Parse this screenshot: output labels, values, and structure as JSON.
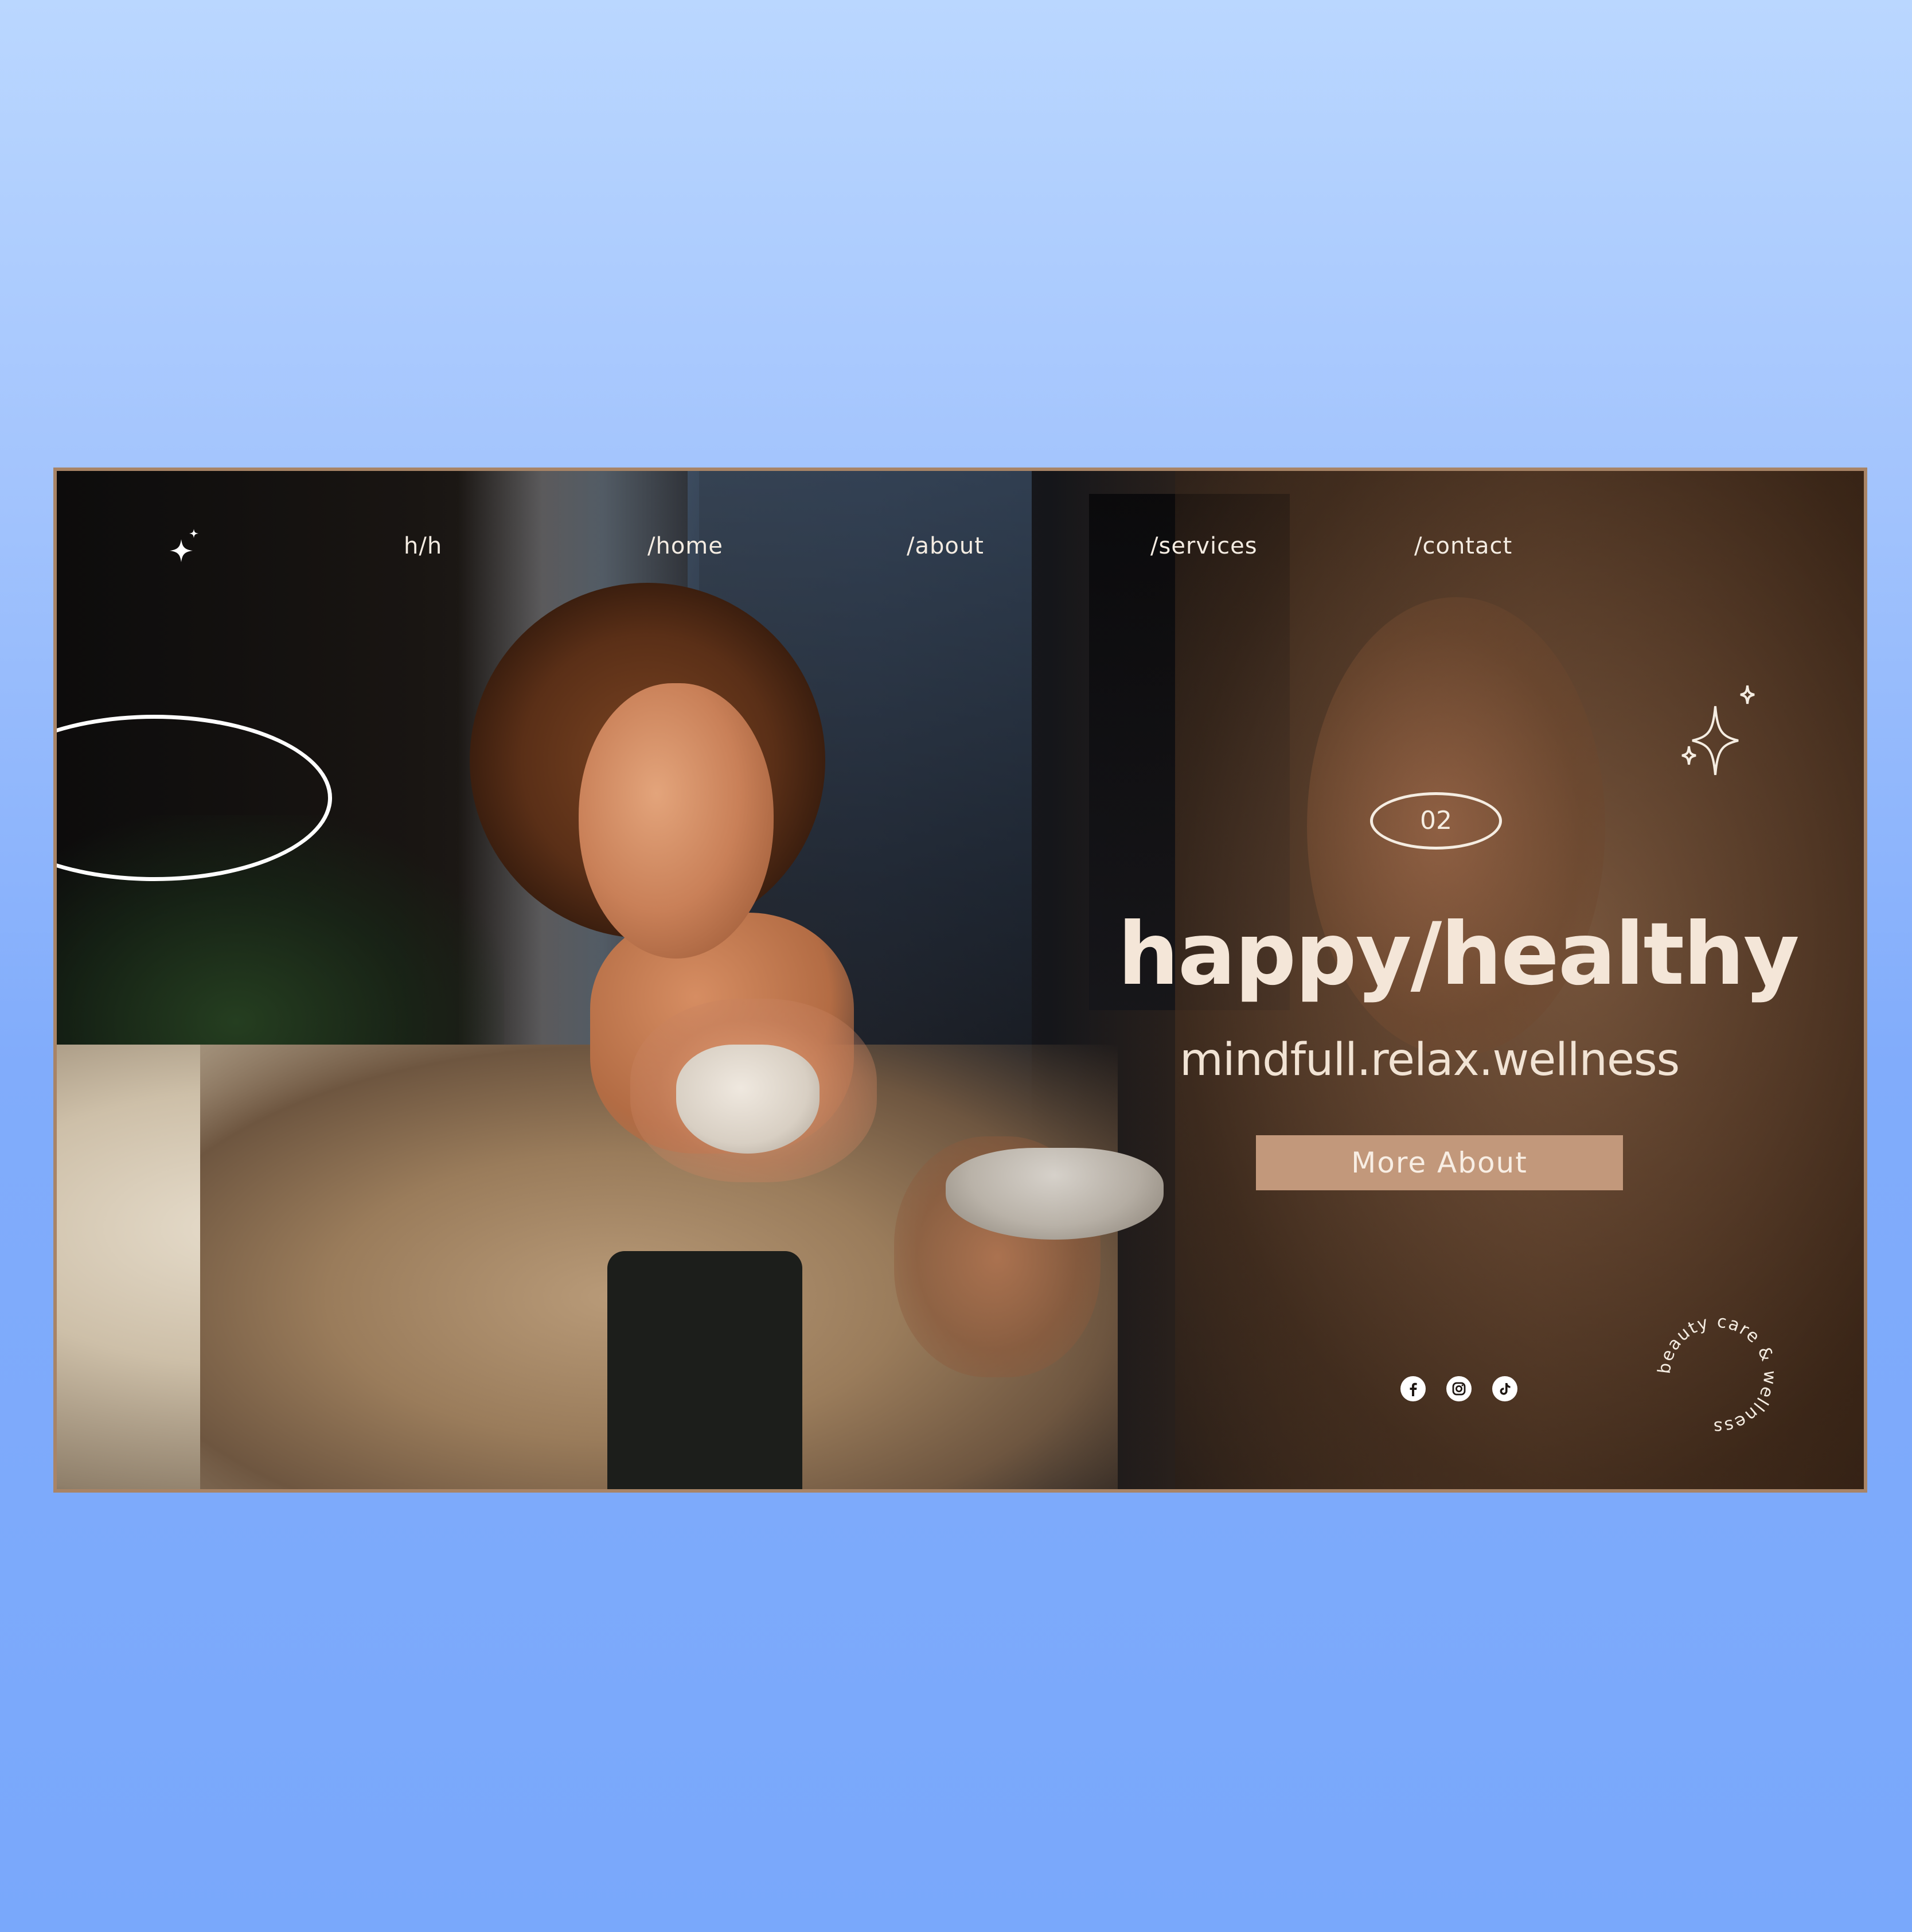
{
  "nav": {
    "logo_icon": "sparkle-icon",
    "items": [
      {
        "label": "h/h"
      },
      {
        "label": "/home"
      },
      {
        "label": "/about"
      },
      {
        "label": "/services"
      },
      {
        "label": "/contact"
      }
    ]
  },
  "hero": {
    "slide_number": "02",
    "title": "happy/healthy",
    "subtitle": "mindfull.relax.wellness",
    "cta_label": "More About",
    "decor_icon": "sparkles-icon"
  },
  "social": [
    {
      "icon": "facebook-icon"
    },
    {
      "icon": "instagram-icon"
    },
    {
      "icon": "tiktok-icon"
    }
  ],
  "badge": {
    "text": "beauty care & wellness"
  },
  "colors": {
    "background_top": "#bad7ff",
    "background_bottom": "#79a8fb",
    "frame_border": "#a88466",
    "accent": "#c2987b",
    "text_light": "#f4e6d8"
  }
}
